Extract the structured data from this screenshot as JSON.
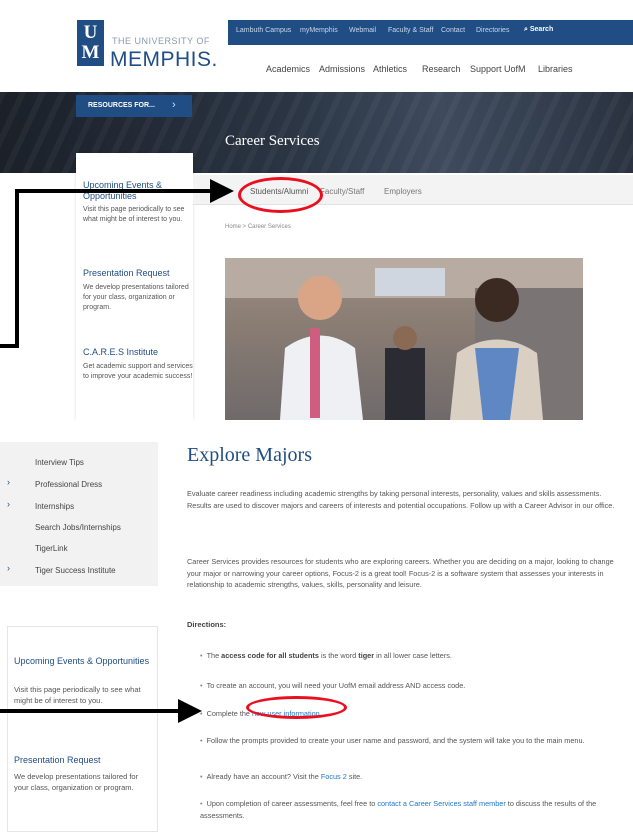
{
  "top": {
    "utility_links": [
      "Lambuth Campus",
      "myMemphis",
      "Webmail",
      "Faculty & Staff",
      "Contact",
      "Directories"
    ],
    "search_label": "Search",
    "logo_university": "THE UNIVERSITY OF",
    "logo_name": "MEMPHIS.",
    "logo_mark_top": "U",
    "logo_mark_bottom": "M",
    "main_nav": [
      "Academics",
      "Admissions",
      "Athletics",
      "Research",
      "Support UofM",
      "Libraries"
    ],
    "resources_label": "RESOURCES FOR...",
    "page_title": "Career Services",
    "subnav": [
      "Students/Alumni",
      "Faculty/Staff",
      "Employers"
    ],
    "breadcrumb": "Home > Career Services",
    "sidebar_card": [
      {
        "heading": "Upcoming Events & Opportunities",
        "body": "Visit this page periodically to see what might be of interest to you."
      },
      {
        "heading": "Presentation Request",
        "body": "We develop presentations tailored for your class, organization or program."
      },
      {
        "heading": "C.A.R.E.S Institute",
        "body": "Get academic support and services to improve your academic success!"
      }
    ]
  },
  "bottom": {
    "side_menu": [
      {
        "label": "Interview Tips",
        "chevron": false
      },
      {
        "label": "Professional Dress",
        "chevron": true
      },
      {
        "label": "Internships",
        "chevron": true
      },
      {
        "label": "Search Jobs/Internships",
        "chevron": false
      },
      {
        "label": "TigerLink",
        "chevron": false
      },
      {
        "label": "Tiger Success Institute",
        "chevron": true
      }
    ],
    "card": [
      {
        "heading": "Upcoming Events & Opportunities",
        "body": "Visit this page periodically to see what might be of interest to you."
      },
      {
        "heading": "Presentation Request",
        "body": "We develop presentations tailored for your class, organization or program."
      }
    ],
    "title": "Explore Majors",
    "para1": "Evaluate career readiness including academic strengths by taking personal interests, personality, values and skills assessments. Results are used to discover majors and careers of interests and potential occupations. Follow up with a Career Advisor in our office.",
    "para2": "Career Services provides resources for students who are exploring careers.  Whether you are deciding on a major, looking to change your major or narrowing your career options, Focus-2 is a great tool!  Focus-2 is a software system that assesses your interests in relationship to academic strengths, values, skills, personality and leisure.",
    "directions_label": "Directions:",
    "bullets": {
      "b1_pre": "The ",
      "b1_bold1": "access code for all students",
      "b1_mid": " is the word ",
      "b1_bold2": "tiger",
      "b1_post": " in all lower case letters.",
      "b2": "To create an account, you will need your UofM email address AND access code.",
      "b3_pre": "Complete the ",
      "b3_link": "new user information",
      "b3_post": ".",
      "b4": "Follow the prompts provided to create your user name and password, and the system will take you to the main menu.",
      "b5_pre": "Already have an account? Visit the ",
      "b5_link": "Focus 2",
      "b5_post": " site.",
      "b6_pre": "Upon completion of career assessments, feel free to ",
      "b6_link": "contact a Career Services staff member",
      "b6_post": " to discuss the results of the assessments."
    }
  },
  "colors": {
    "brand_blue": "#1f4d84",
    "annotation_red": "#ea0f1e",
    "link_blue": "#1f77c8"
  }
}
